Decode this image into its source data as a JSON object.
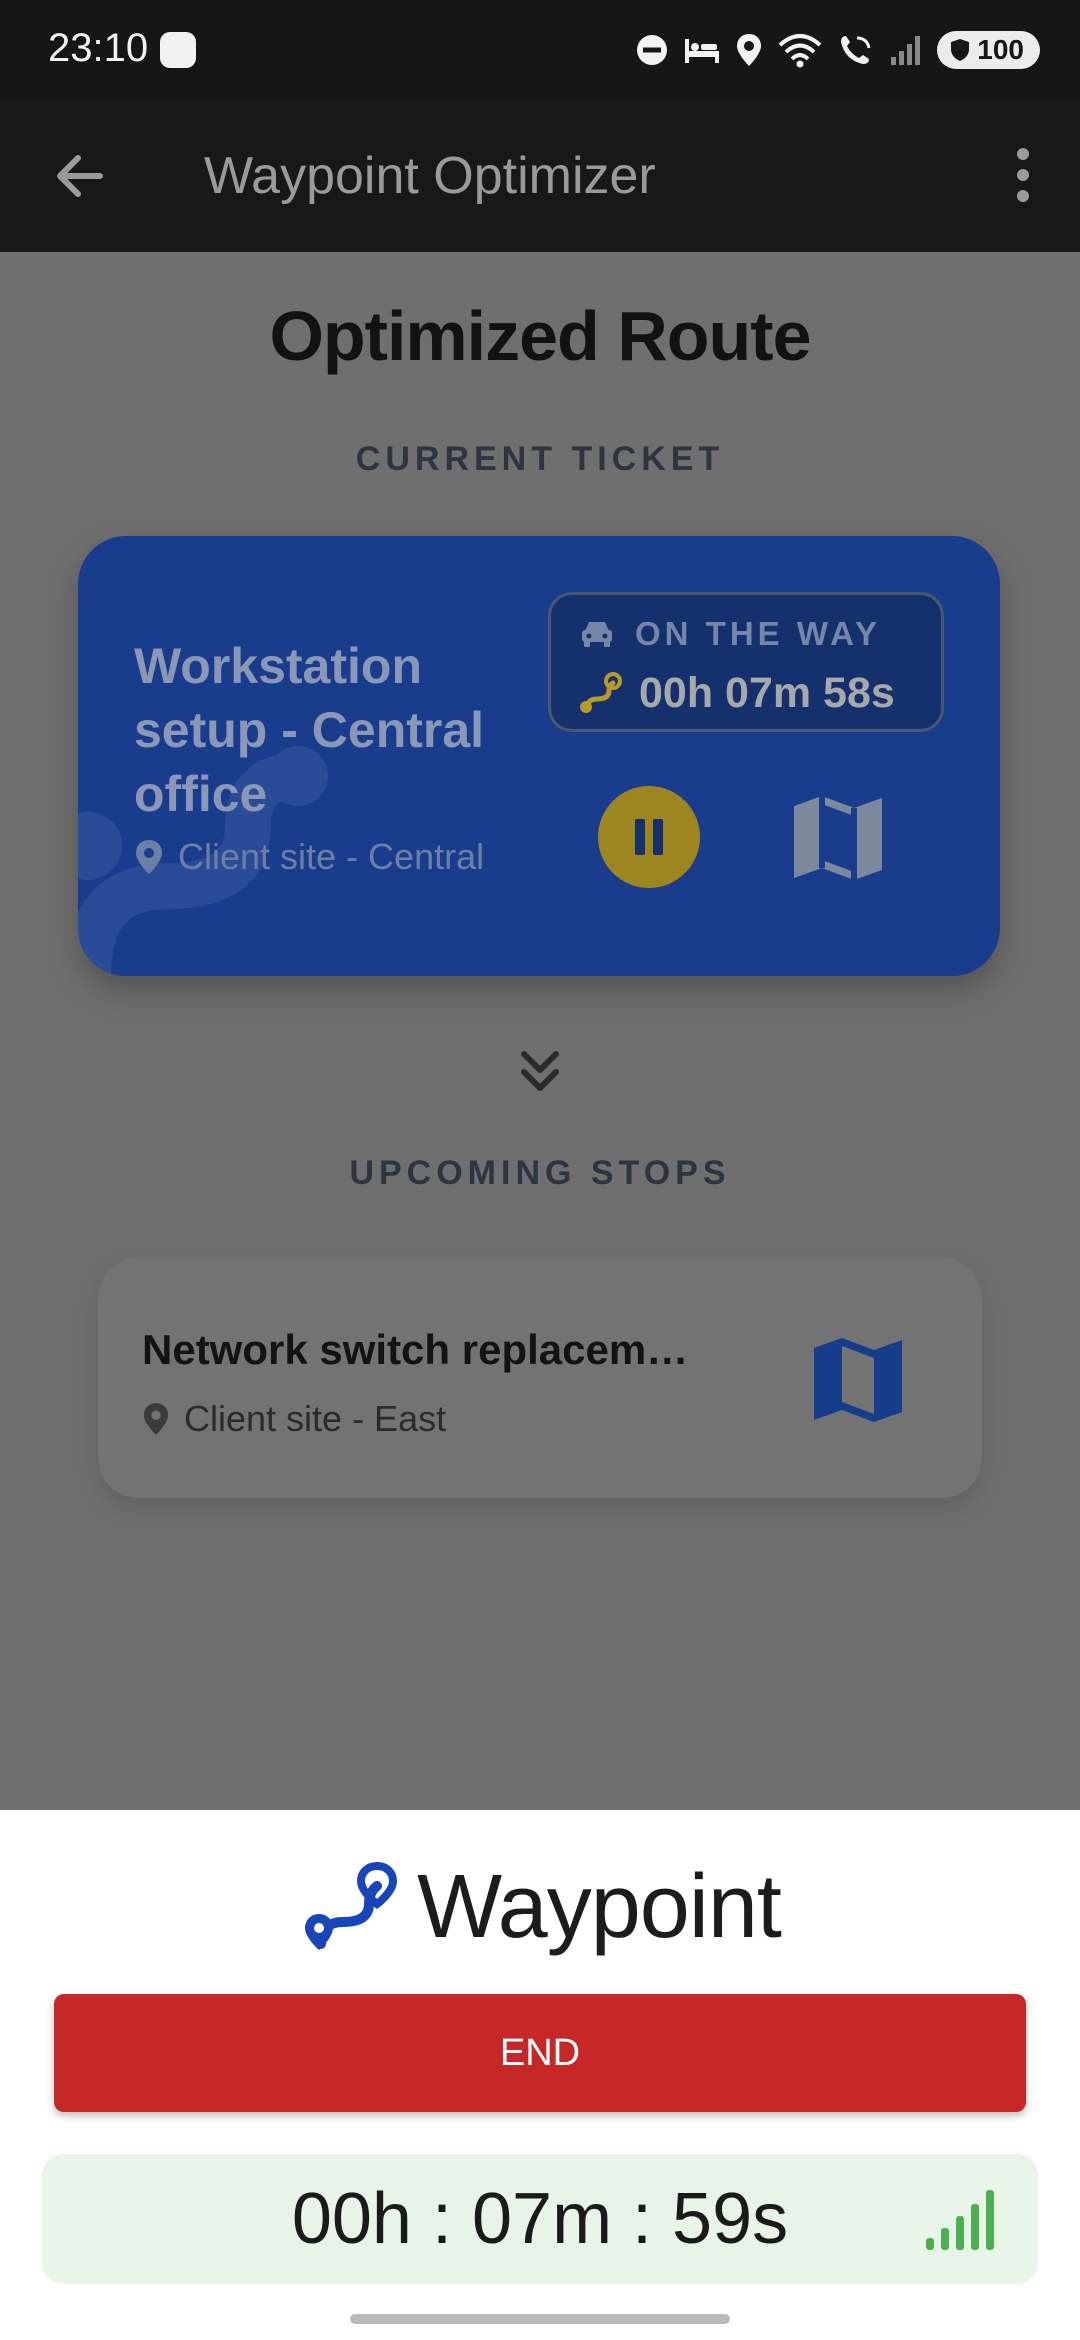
{
  "status_bar": {
    "time": "23:10",
    "battery": "100",
    "icons": [
      "dnd-icon",
      "bed-icon",
      "location-icon",
      "wifi-icon",
      "wifi-calling-icon",
      "signal-icon",
      "battery-shield-icon"
    ]
  },
  "app_bar": {
    "title": "Waypoint Optimizer",
    "back_icon": "arrow-left-icon",
    "menu_icon": "more-vert-icon"
  },
  "main": {
    "page_title": "Optimized Route",
    "current_section": "CURRENT TICKET",
    "current_ticket": {
      "title": "Workstation setup - Central office",
      "location": "Client site - Central",
      "status": "ON THE WAY",
      "timer": "00h 07m 58s"
    },
    "upcoming_section": "UPCOMING STOPS",
    "upcoming_stops": [
      {
        "title": "Network switch replacement",
        "location": "Client site - East"
      }
    ]
  },
  "bottom_sheet": {
    "brand": "Waypoint",
    "end_label": "END",
    "timer": "00h : 07m : 59s"
  },
  "colors": {
    "primary_blue": "#1a3c8c",
    "end_red": "#c62828",
    "pause_yellow": "#9d851f",
    "timer_bg": "#e7f4e7",
    "signal_green": "#4caf50"
  }
}
